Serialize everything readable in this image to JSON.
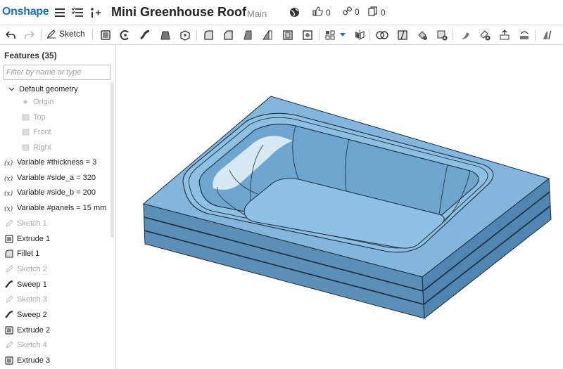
{
  "app": {
    "logo": "Onshape"
  },
  "document": {
    "title": "Mini Greenhouse Roof",
    "branch": "Main"
  },
  "stats": {
    "likes": "0",
    "links": "0",
    "copies": "0"
  },
  "toolbar": {
    "sketch_label": "Sketch"
  },
  "panel": {
    "header": "Features (35)",
    "filter_placeholder": "Filter by name or type",
    "default_geometry": "Default geometry",
    "geometry_items": [
      "Origin",
      "Top",
      "Front",
      "Right"
    ],
    "features": [
      {
        "icon": "variable-icon",
        "label": "Variable #thickness = 3",
        "dim": false
      },
      {
        "icon": "variable-icon",
        "label": "Variable #side_a = 320",
        "dim": false
      },
      {
        "icon": "variable-icon",
        "label": "Variable #side_b = 200",
        "dim": false
      },
      {
        "icon": "variable-icon",
        "label": "Variable #panels = 15 mm",
        "dim": false
      },
      {
        "icon": "sketch-icon",
        "label": "Sketch 1",
        "dim": true
      },
      {
        "icon": "extrude-icon",
        "label": "Extrude 1",
        "dim": false
      },
      {
        "icon": "fillet-icon",
        "label": "Fillet 1",
        "dim": false
      },
      {
        "icon": "sketch-icon",
        "label": "Sketch 2",
        "dim": true
      },
      {
        "icon": "sweep-icon",
        "label": "Sweep 1",
        "dim": false
      },
      {
        "icon": "sketch-icon",
        "label": "Sketch 3",
        "dim": true
      },
      {
        "icon": "sweep-icon",
        "label": "Sweep 2",
        "dim": false
      },
      {
        "icon": "extrude-icon",
        "label": "Extrude 2",
        "dim": false
      },
      {
        "icon": "sketch-icon",
        "label": "Sketch 4",
        "dim": true
      },
      {
        "icon": "extrude-icon",
        "label": "Extrude 3",
        "dim": false
      }
    ]
  },
  "colors": {
    "brand": "#1f6fb3",
    "model_face": "#8ab8dd",
    "model_top": "#7fb2d9",
    "model_side": "#5b8fb8"
  }
}
